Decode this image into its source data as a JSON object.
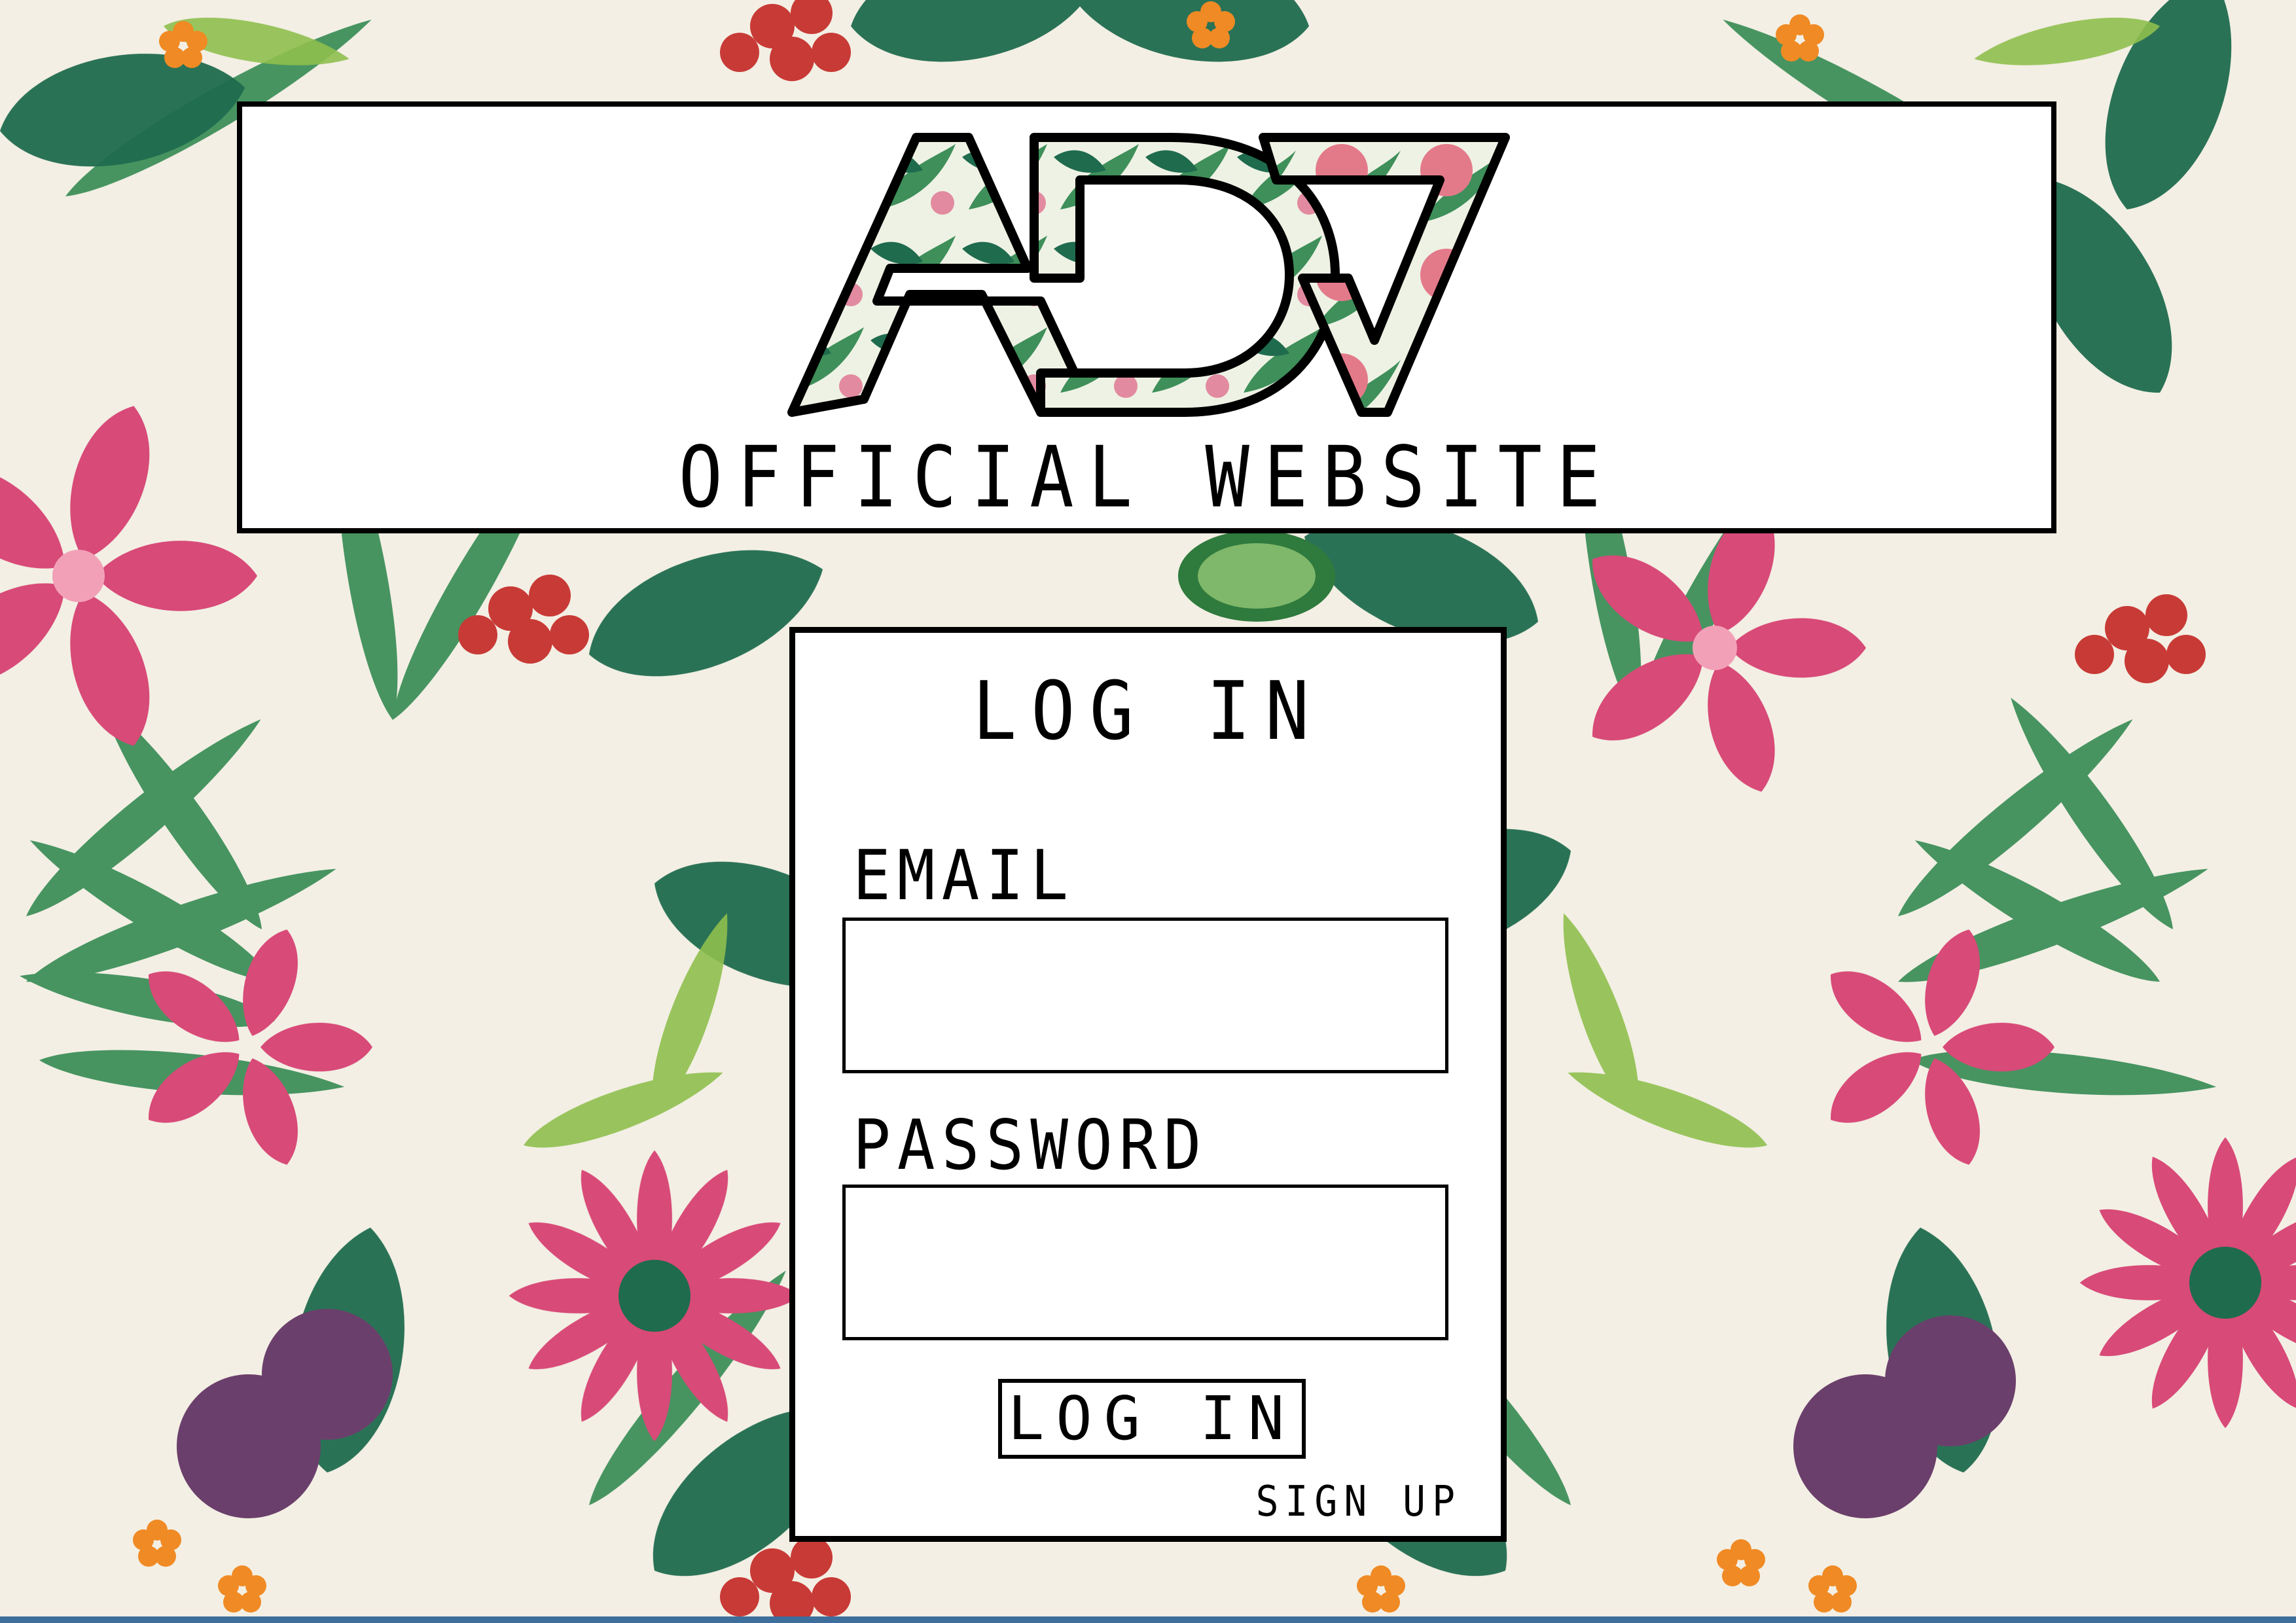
{
  "header": {
    "logo_text": "ADV",
    "subtitle": "OFFICIAL WEBSITE"
  },
  "login": {
    "title": "LOG IN",
    "email_label": "EMAIL",
    "email_value": "",
    "password_label": "PASSWORD",
    "password_value": "",
    "button_label": "LOG IN",
    "signup_label": "SIGN UP"
  },
  "colors": {
    "background": "#f3efe4",
    "leaf_dark": "#1f6b4e",
    "leaf_mid": "#3e8f5a",
    "leaf_light": "#8fbf4d",
    "flower_pink": "#d84a78",
    "berry_red": "#c83a36",
    "plum": "#6b3f6b",
    "border": "#000000",
    "bottom_strip": "#3d6e9c"
  }
}
